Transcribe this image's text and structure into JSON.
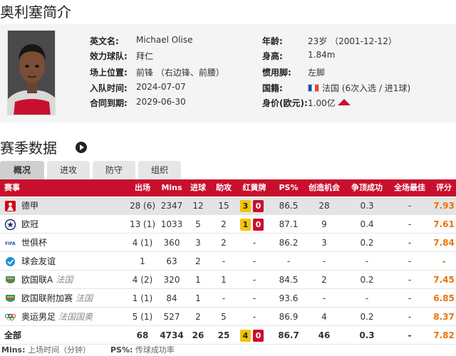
{
  "profile": {
    "title": "奥利塞简介",
    "left": [
      {
        "label": "英文名:",
        "value": "Michael Olise"
      },
      {
        "label": "效力球队:",
        "value": "拜仁"
      },
      {
        "label": "场上位置:",
        "value": "前锋 （右边锋、前腰）"
      },
      {
        "label": "入队时间:",
        "value": "2024-07-07"
      },
      {
        "label": "合同到期:",
        "value": "2029-06-30"
      }
    ],
    "right": [
      {
        "label": "年龄:",
        "value": "23岁 （2001-12-12）"
      },
      {
        "label": "身高:",
        "value": "1.84m"
      },
      {
        "label": "惯用脚:",
        "value": "左脚"
      },
      {
        "label": "国籍:",
        "value": "法国 (6次入选 / 进1球)"
      },
      {
        "label": "身价(欧元):",
        "value": "1.00亿"
      }
    ],
    "nationality_flag_icon": "france-flag-icon",
    "value_trend_icon": "trend-up-icon"
  },
  "stats": {
    "title": "赛季数据",
    "tabs": [
      "概况",
      "进攻",
      "防守",
      "组织"
    ],
    "active_tab": 0,
    "headers": [
      "赛事",
      "出场",
      "Mins",
      "进球",
      "助攻",
      "红黄牌",
      "PS%",
      "创造机会",
      "争顶成功",
      "全场最佳",
      "评分"
    ],
    "rows": [
      {
        "comp": "德甲",
        "sub": "",
        "apps": "28 (6)",
        "mins": "2347",
        "goals": "12",
        "assists": "15",
        "yellow": "3",
        "red": "0",
        "ps": "86.5",
        "chances": "28",
        "aerials": "0.3",
        "motm": "-",
        "rating": "7.93",
        "logo": "bundesliga-logo-icon"
      },
      {
        "comp": "欧冠",
        "sub": "",
        "apps": "13 (1)",
        "mins": "1033",
        "goals": "5",
        "assists": "2",
        "yellow": "1",
        "red": "0",
        "ps": "87.1",
        "chances": "9",
        "aerials": "0.4",
        "motm": "-",
        "rating": "7.61",
        "logo": "champions-league-logo-icon"
      },
      {
        "comp": "世俱杯",
        "sub": "",
        "apps": "4 (1)",
        "mins": "360",
        "goals": "3",
        "assists": "2",
        "yellow": "",
        "red": "",
        "cards_text": "-",
        "ps": "86.2",
        "chances": "3",
        "aerials": "0.2",
        "motm": "-",
        "rating": "7.84",
        "logo": "fifa-logo-icon"
      },
      {
        "comp": "球会友谊",
        "sub": "",
        "apps": "1",
        "mins": "63",
        "goals": "2",
        "assists": "-",
        "yellow": "",
        "red": "",
        "cards_text": "-",
        "ps": "-",
        "chances": "-",
        "aerials": "-",
        "motm": "-",
        "rating": "-",
        "logo": "friendly-logo-icon"
      },
      {
        "comp": "欧国联A",
        "sub": "法国",
        "apps": "4 (2)",
        "mins": "320",
        "goals": "1",
        "assists": "1",
        "yellow": "",
        "red": "",
        "cards_text": "-",
        "ps": "84.5",
        "chances": "2",
        "aerials": "0.2",
        "motm": "-",
        "rating": "7.45",
        "logo": "nations-league-logo-icon"
      },
      {
        "comp": "欧国联附加赛",
        "sub": "法国",
        "apps": "1 (1)",
        "mins": "84",
        "goals": "1",
        "assists": "-",
        "yellow": "",
        "red": "",
        "cards_text": "-",
        "ps": "93.6",
        "chances": "-",
        "aerials": "-",
        "motm": "-",
        "rating": "6.85",
        "logo": "nations-league-logo-icon"
      },
      {
        "comp": "奥运男足",
        "sub": "法国国奥",
        "apps": "5 (1)",
        "mins": "527",
        "goals": "2",
        "assists": "5",
        "yellow": "",
        "red": "",
        "cards_text": "-",
        "ps": "86.9",
        "chances": "4",
        "aerials": "0.2",
        "motm": "-",
        "rating": "8.37",
        "logo": "olympics-logo-icon"
      }
    ],
    "total": {
      "comp": "全部",
      "apps": "68",
      "mins": "4734",
      "goals": "26",
      "assists": "25",
      "yellow": "4",
      "red": "0",
      "ps": "86.7",
      "chances": "46",
      "aerials": "0.3",
      "motm": "-",
      "rating": "7.82"
    }
  },
  "footnote": {
    "mins_key": "Mins:",
    "mins_desc": " 上场时间（分钟）",
    "ps_key": "PS%:",
    "ps_desc": " 传球成功率"
  },
  "colors": {
    "accent": "#c8102e",
    "rating": "#e8730a",
    "yellow_card": "#f5c400",
    "red_card": "#c8102e"
  }
}
